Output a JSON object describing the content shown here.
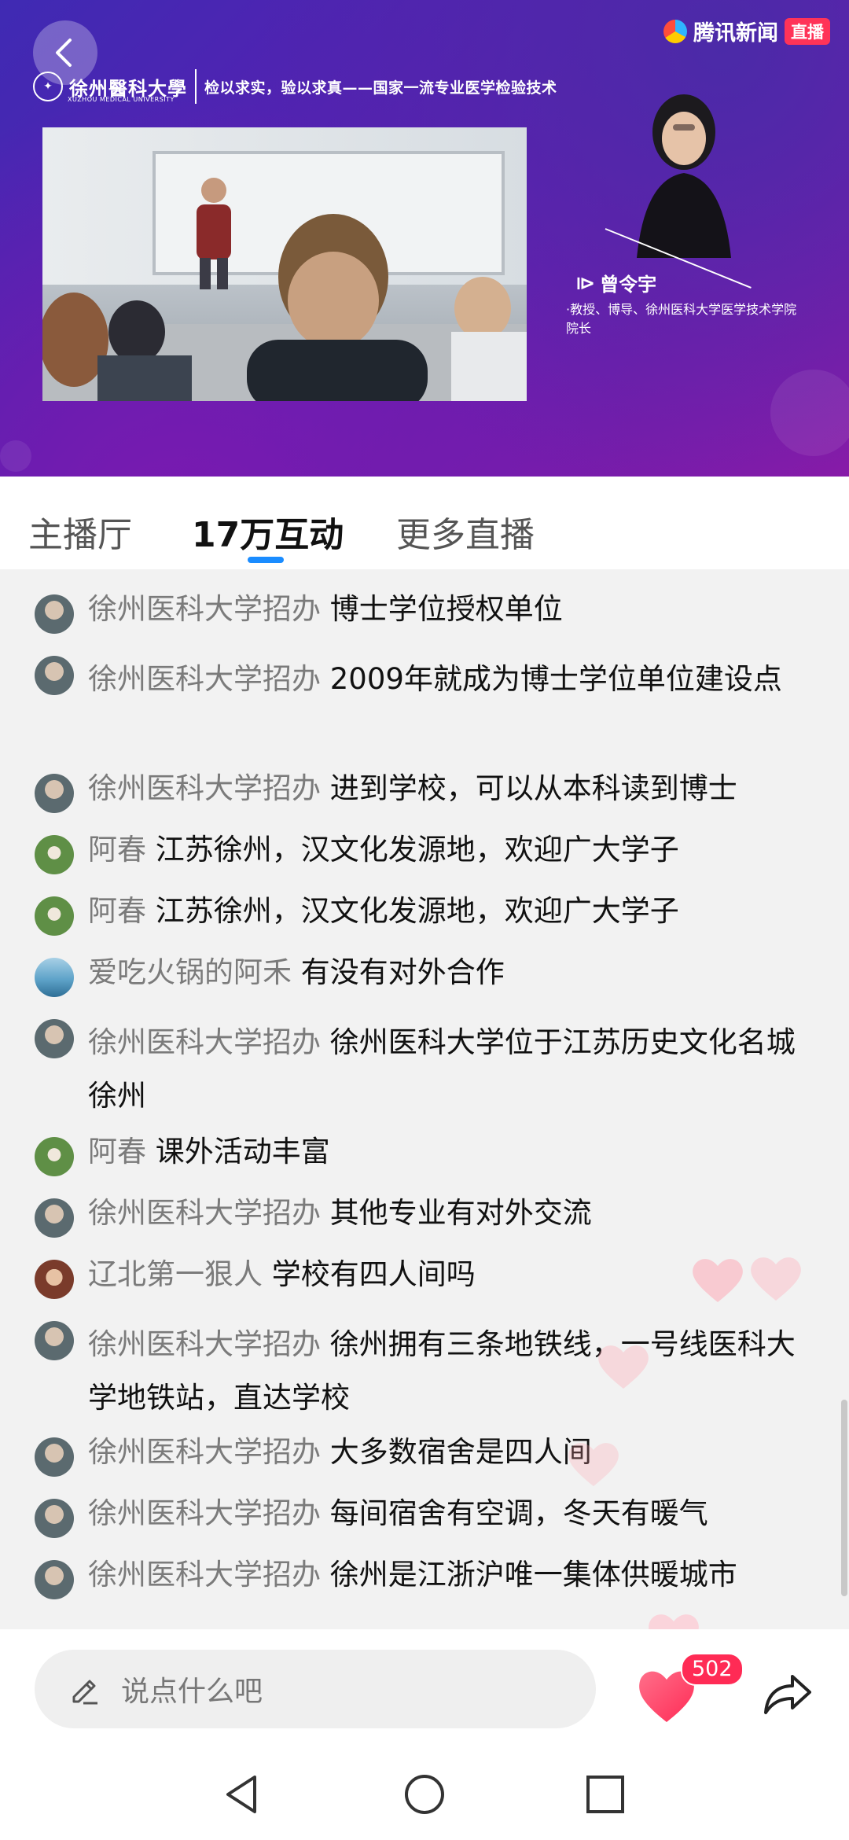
{
  "video": {
    "brand_name": "腾讯新闻",
    "live_badge": "直播",
    "school_name": "徐州醫科大學",
    "school_name_en": "XUZHOU MEDICAL UNIVERSITY",
    "slogan": "检以求实，验以求真——国家一流专业医学检验技术",
    "presenter_name": "曾令宇",
    "presenter_title": "·教授、博导、徐州医科大学医学技术学院院长"
  },
  "tabs": [
    {
      "label": "主播厅",
      "active": false
    },
    {
      "label": "17万互动",
      "active": true
    },
    {
      "label": "更多直播",
      "active": false
    }
  ],
  "comments": [
    {
      "user": "徐州医科大学招办",
      "text": "博士学位授权单位",
      "avatar": "office"
    },
    {
      "user": "徐州医科大学招办",
      "text": "2009年就成为博士学位单位建设点",
      "avatar": "office"
    },
    {
      "user": "徐州医科大学招办",
      "text": "进到学校，可以从本科读到博士",
      "avatar": "office"
    },
    {
      "user": "阿春",
      "text": "江苏徐州，汉文化发源地，欢迎广大学子",
      "avatar": "chun"
    },
    {
      "user": "阿春",
      "text": "江苏徐州，汉文化发源地，欢迎广大学子",
      "avatar": "chun"
    },
    {
      "user": "爱吃火锅的阿禾",
      "text": "有没有对外合作",
      "avatar": "hotpot"
    },
    {
      "user": "徐州医科大学招办",
      "text": "徐州医科大学位于江苏历史文化名城徐州",
      "avatar": "office"
    },
    {
      "user": "阿春",
      "text": "课外活动丰富",
      "avatar": "chun"
    },
    {
      "user": "徐州医科大学招办",
      "text": "其他专业有对外交流",
      "avatar": "office"
    },
    {
      "user": "辽北第一狠人",
      "text": "学校有四人间吗",
      "avatar": "liao"
    },
    {
      "user": "徐州医科大学招办",
      "text": "徐州拥有三条地铁线，一号线医科大学地铁站，直达学校",
      "avatar": "office"
    },
    {
      "user": "徐州医科大学招办",
      "text": "大多数宿舍是四人间",
      "avatar": "office"
    },
    {
      "user": "徐州医科大学招办",
      "text": "每间宿舍有空调，冬天有暖气",
      "avatar": "office"
    },
    {
      "user": "徐州医科大学招办",
      "text": "徐州是江浙沪唯一集体供暖城市",
      "avatar": "office"
    }
  ],
  "input": {
    "placeholder": "说点什么吧"
  },
  "like": {
    "count": "502"
  },
  "icons": {
    "back": "back-arrow-icon",
    "edit": "pencil-icon",
    "like": "heart-icon",
    "share": "share-icon",
    "nav_back": "triangle-back-icon",
    "nav_home": "circle-home-icon",
    "nav_recent": "square-recent-icon"
  },
  "colors": {
    "accent": "#1a8cff",
    "like": "#ff2b55",
    "username": "#7b7b7b"
  }
}
